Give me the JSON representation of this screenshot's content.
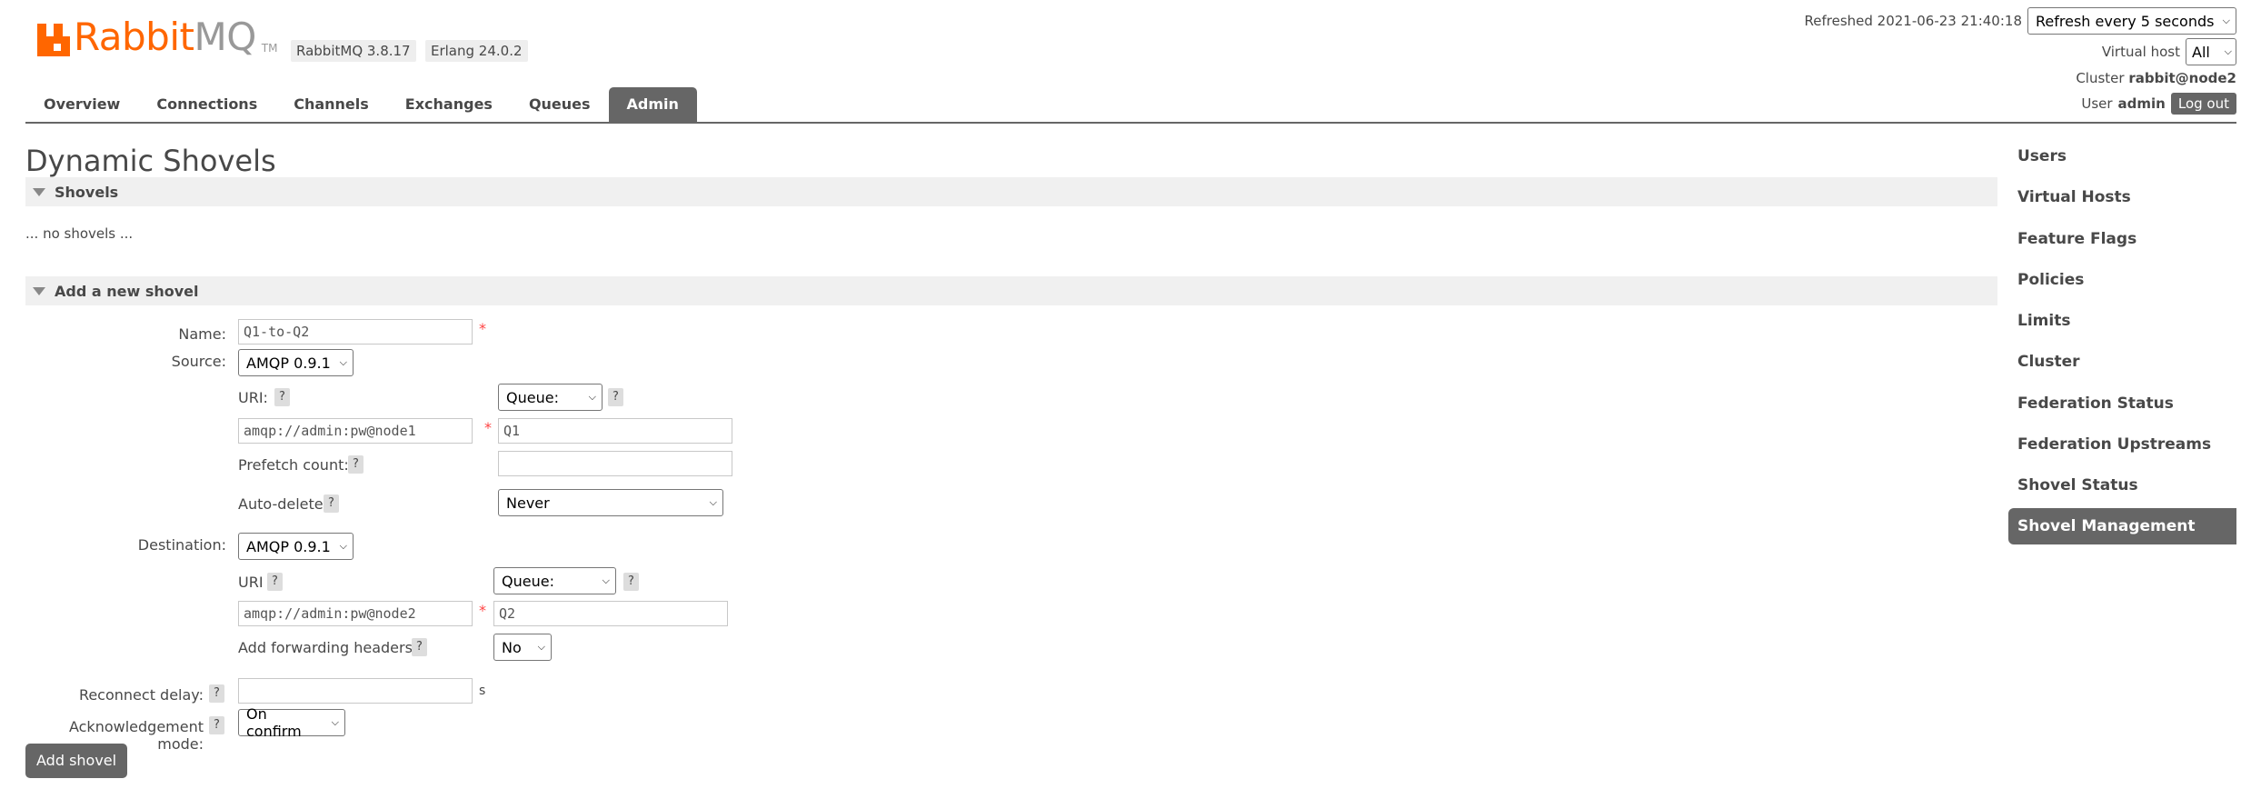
{
  "header": {
    "brand_rabbit": "Rabbit",
    "brand_mq": "MQ",
    "brand_tm": "TM",
    "version_badge": "RabbitMQ 3.8.17",
    "erlang_badge": "Erlang 24.0.2",
    "refreshed_label": "Refreshed 2021-06-23 21:40:18",
    "refresh_select": "Refresh every 5 seconds",
    "virtual_host_label": "Virtual host",
    "virtual_host_value": "All",
    "cluster_label": "Cluster",
    "cluster_value": "rabbit@node2",
    "user_label": "User",
    "user_value": "admin",
    "logout_label": "Log out"
  },
  "tabs": [
    {
      "label": "Overview"
    },
    {
      "label": "Connections"
    },
    {
      "label": "Channels"
    },
    {
      "label": "Exchanges"
    },
    {
      "label": "Queues"
    },
    {
      "label": "Admin",
      "active": true
    }
  ],
  "page": {
    "title": "Dynamic Shovels",
    "shovels_section": "Shovels",
    "no_shovels": "... no shovels ...",
    "add_section": "Add a new shovel"
  },
  "form": {
    "name_label": "Name:",
    "name_value": "Q1-to-Q2",
    "source_label": "Source:",
    "source_protocol": "AMQP 0.9.1",
    "source_uri_label": "URI:",
    "source_uri_value": "amqp://admin:pw@node1",
    "source_type": "Queue:",
    "source_queue_value": "Q1",
    "prefetch_label": "Prefetch count:",
    "prefetch_value": "",
    "auto_delete_label": "Auto-delete",
    "auto_delete_value": "Never",
    "destination_label": "Destination:",
    "destination_protocol": "AMQP 0.9.1",
    "dest_uri_label": "URI",
    "dest_uri_value": "amqp://admin:pw@node2",
    "dest_type": "Queue:",
    "dest_queue_value": "Q2",
    "fwd_headers_label": "Add forwarding headers:",
    "fwd_headers_value": "No",
    "reconnect_label": "Reconnect delay:",
    "reconnect_value": "",
    "reconnect_unit": "s",
    "ack_label": "Acknowledgement mode:",
    "ack_value": "On confirm",
    "required_mark": "*",
    "help_mark": "?",
    "submit_label": "Add shovel"
  },
  "sidebar": {
    "items": [
      {
        "label": "Users"
      },
      {
        "label": "Virtual Hosts"
      },
      {
        "label": "Feature Flags"
      },
      {
        "label": "Policies"
      },
      {
        "label": "Limits"
      },
      {
        "label": "Cluster"
      },
      {
        "label": "Federation Status"
      },
      {
        "label": "Federation Upstreams"
      },
      {
        "label": "Shovel Status"
      },
      {
        "label": "Shovel Management",
        "active": true
      }
    ]
  },
  "colors": {
    "brand_orange": "#ff6600",
    "active_tab": "#666666",
    "required": "#ff4444"
  }
}
